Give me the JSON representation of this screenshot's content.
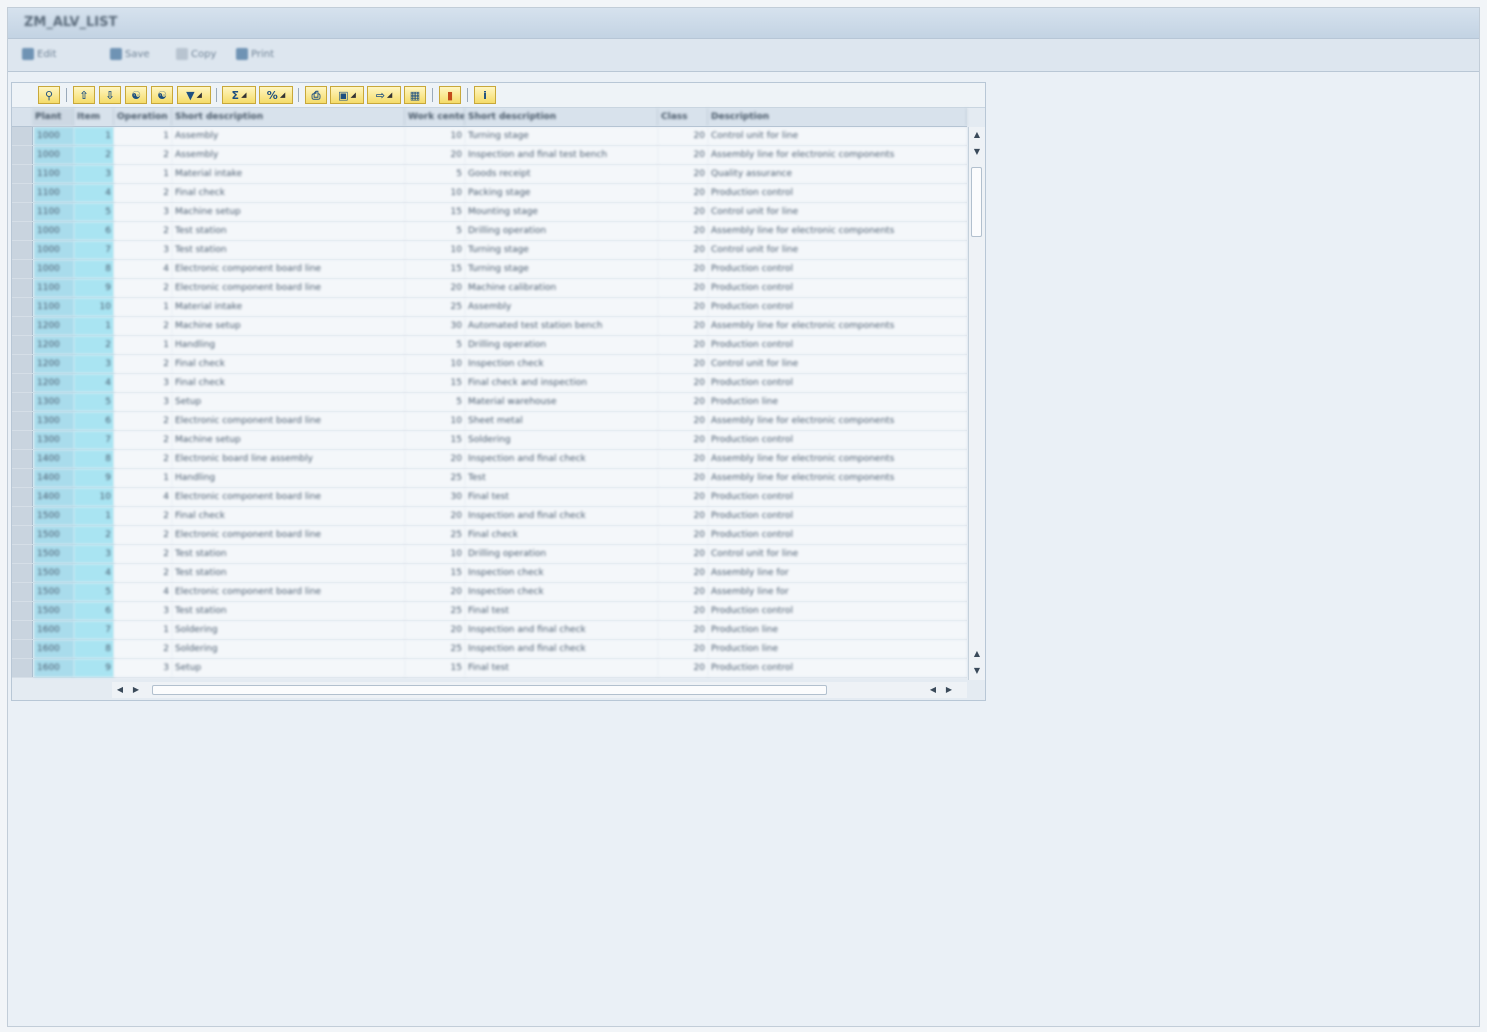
{
  "window": {
    "title": "ZM_ALV_LIST"
  },
  "appbar": {
    "buttons": [
      {
        "label": "Edit",
        "icon": "edit-icon"
      },
      {
        "label": "Save",
        "icon": "save-icon"
      },
      {
        "label": "Copy",
        "icon": "copy-icon"
      },
      {
        "label": "Print",
        "icon": "print-icon"
      }
    ]
  },
  "toolbar": {
    "icons": [
      "details-icon",
      "sort-ascending-icon",
      "sort-descending-icon",
      "find-icon",
      "find-next-icon",
      "filter-icon",
      "sum-icon",
      "subtotal-icon",
      "print-preview-icon",
      "views-icon",
      "export-icon",
      "layout-icon",
      "graphic-icon",
      "info-icon"
    ]
  },
  "table": {
    "columns": [
      "Plant",
      "Item",
      "Operation",
      "Short description",
      "Work center",
      "Short description",
      "Class",
      "Description"
    ],
    "rows": [
      [
        "1000",
        "1",
        "1",
        "Assembly",
        "10",
        "Turning stage",
        "20",
        "Control unit for line"
      ],
      [
        "1000",
        "2",
        "2",
        "Assembly",
        "20",
        "Inspection and final test bench",
        "20",
        "Assembly line for electronic components"
      ],
      [
        "1100",
        "3",
        "1",
        "Material intake",
        "5",
        "Goods receipt",
        "20",
        "Quality assurance"
      ],
      [
        "1100",
        "4",
        "2",
        "Final check",
        "10",
        "Packing stage",
        "20",
        "Production control"
      ],
      [
        "1100",
        "5",
        "3",
        "Machine setup",
        "15",
        "Mounting stage",
        "20",
        "Control unit for line"
      ],
      [
        "1000",
        "6",
        "2",
        "Test station",
        "5",
        "Drilling operation",
        "20",
        "Assembly line for electronic components"
      ],
      [
        "1000",
        "7",
        "3",
        "Test station",
        "10",
        "Turning stage",
        "20",
        "Control unit for line"
      ],
      [
        "1000",
        "8",
        "4",
        "Electronic component board line",
        "15",
        "Turning stage",
        "20",
        "Production control"
      ],
      [
        "1100",
        "9",
        "2",
        "Electronic component board line",
        "20",
        "Machine calibration",
        "20",
        "Production control"
      ],
      [
        "1100",
        "10",
        "1",
        "Material intake",
        "25",
        "Assembly",
        "20",
        "Production control"
      ],
      [
        "1200",
        "1",
        "2",
        "Machine setup",
        "30",
        "Automated test station bench",
        "20",
        "Assembly line for electronic components"
      ],
      [
        "1200",
        "2",
        "1",
        "Handling",
        "5",
        "Drilling operation",
        "20",
        "Production control"
      ],
      [
        "1200",
        "3",
        "2",
        "Final check",
        "10",
        "Inspection check",
        "20",
        "Control unit for line"
      ],
      [
        "1200",
        "4",
        "3",
        "Final check",
        "15",
        "Final check and inspection",
        "20",
        "Production control"
      ],
      [
        "1300",
        "5",
        "3",
        "Setup",
        "5",
        "Material warehouse",
        "20",
        "Production line"
      ],
      [
        "1300",
        "6",
        "2",
        "Electronic component board line",
        "10",
        "Sheet metal",
        "20",
        "Assembly line for electronic components"
      ],
      [
        "1300",
        "7",
        "2",
        "Machine setup",
        "15",
        "Soldering",
        "20",
        "Production control"
      ],
      [
        "1400",
        "8",
        "2",
        "Electronic board line assembly",
        "20",
        "Inspection and final check",
        "20",
        "Assembly line for electronic components"
      ],
      [
        "1400",
        "9",
        "1",
        "Handling",
        "25",
        "Test",
        "20",
        "Assembly line for electronic components"
      ],
      [
        "1400",
        "10",
        "4",
        "Electronic component board line",
        "30",
        "Final test",
        "20",
        "Production control"
      ],
      [
        "1500",
        "1",
        "2",
        "Final check",
        "20",
        "Inspection and final check",
        "20",
        "Production control"
      ],
      [
        "1500",
        "2",
        "2",
        "Electronic component board line",
        "25",
        "Final check",
        "20",
        "Production control"
      ],
      [
        "1500",
        "3",
        "2",
        "Test station",
        "10",
        "Drilling operation",
        "20",
        "Control unit for line"
      ],
      [
        "1500",
        "4",
        "2",
        "Test station",
        "15",
        "Inspection check",
        "20",
        "Assembly line for"
      ],
      [
        "1500",
        "5",
        "4",
        "Electronic component board line",
        "20",
        "Inspection check",
        "20",
        "Assembly line for"
      ],
      [
        "1500",
        "6",
        "3",
        "Test station",
        "25",
        "Final test",
        "20",
        "Production control"
      ],
      [
        "1600",
        "7",
        "1",
        "Soldering",
        "20",
        "Inspection and final check",
        "20",
        "Production line"
      ],
      [
        "1600",
        "8",
        "2",
        "Soldering",
        "25",
        "Inspection and final check",
        "20",
        "Production line"
      ],
      [
        "1600",
        "9",
        "3",
        "Setup",
        "15",
        "Final test",
        "20",
        "Production control"
      ]
    ]
  }
}
